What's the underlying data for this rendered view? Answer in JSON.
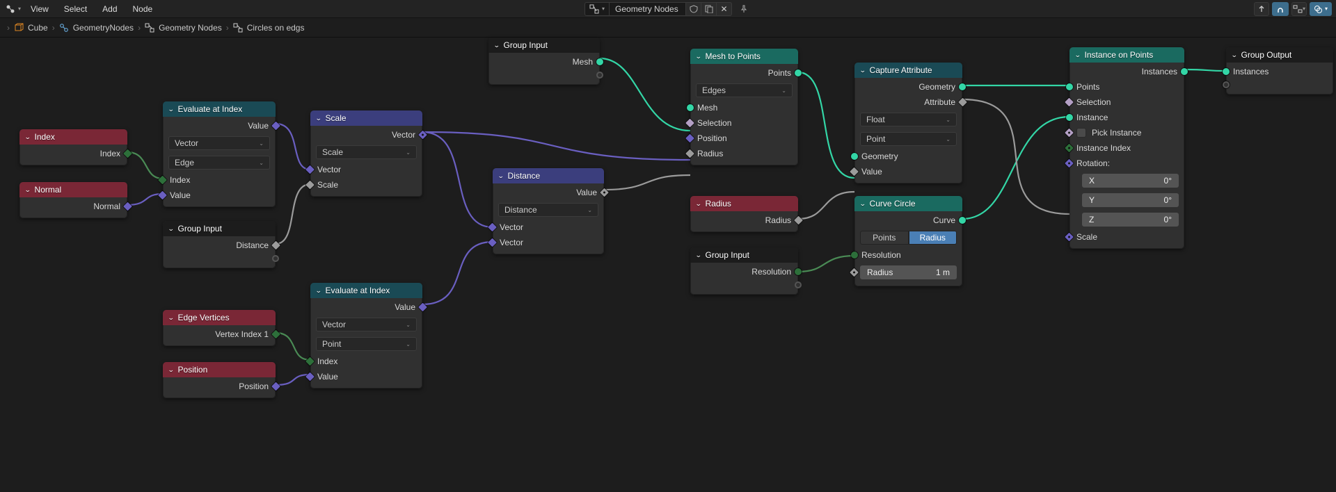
{
  "topbar": {
    "menu": [
      "View",
      "Select",
      "Add",
      "Node"
    ],
    "tree_type": "Geometry Nodes",
    "right_toggles": {}
  },
  "breadcrumb": {
    "items": [
      "Cube",
      "GeometryNodes",
      "Geometry Nodes",
      "Circles on edgs"
    ]
  },
  "nodes": {
    "group_input_top": {
      "title": "Group Input",
      "outs": {
        "mesh": "Mesh"
      }
    },
    "index": {
      "title": "Index",
      "outs": {
        "index": "Index"
      }
    },
    "normal": {
      "title": "Normal",
      "outs": {
        "normal": "Normal"
      }
    },
    "eval1": {
      "title": "Evaluate at Index",
      "outs": {
        "value": "Value"
      },
      "sel1": "Vector",
      "sel2": "Edge",
      "ins": {
        "index": "Index",
        "value": "Value"
      }
    },
    "group_input_mid": {
      "title": "Group Input",
      "outs": {
        "distance": "Distance"
      }
    },
    "edge_vertices": {
      "title": "Edge Vertices",
      "outs": {
        "v1": "Vertex Index 1"
      }
    },
    "position": {
      "title": "Position",
      "outs": {
        "position": "Position"
      }
    },
    "eval2": {
      "title": "Evaluate at Index",
      "outs": {
        "value": "Value"
      },
      "sel1": "Vector",
      "sel2": "Point",
      "ins": {
        "index": "Index",
        "value": "Value"
      }
    },
    "scale": {
      "title": "Scale",
      "outs": {
        "vector": "Vector"
      },
      "sel1": "Scale",
      "ins": {
        "vector": "Vector",
        "scale": "Scale"
      }
    },
    "distance": {
      "title": "Distance",
      "outs": {
        "value": "Value"
      },
      "sel1": "Distance",
      "ins": {
        "v1": "Vector",
        "v2": "Vector"
      }
    },
    "mesh_to_points": {
      "title": "Mesh to Points",
      "outs": {
        "points": "Points"
      },
      "sel1": "Edges",
      "ins": {
        "mesh": "Mesh",
        "selection": "Selection",
        "position": "Position",
        "radius": "Radius"
      }
    },
    "radius": {
      "title": "Radius",
      "outs": {
        "radius": "Radius"
      }
    },
    "group_input_res": {
      "title": "Group Input",
      "outs": {
        "resolution": "Resolution"
      }
    },
    "capture": {
      "title": "Capture Attribute",
      "outs": {
        "geometry": "Geometry",
        "attribute": "Attribute"
      },
      "sel1": "Float",
      "sel2": "Point",
      "ins": {
        "geometry": "Geometry",
        "value": "Value"
      }
    },
    "curve_circle": {
      "title": "Curve Circle",
      "outs": {
        "curve": "Curve"
      },
      "opts": {
        "points": "Points",
        "radius": "Radius"
      },
      "ins": {
        "resolution": "Resolution"
      },
      "radius_label": "Radius",
      "radius_val": "1 m"
    },
    "instance": {
      "title": "Instance on Points",
      "outs": {
        "instances": "Instances"
      },
      "ins": {
        "points": "Points",
        "selection": "Selection",
        "instance": "Instance",
        "pick": "Pick Instance",
        "index": "Instance Index",
        "rotation": "Rotation:",
        "scale": "Scale"
      },
      "rot": {
        "x_l": "X",
        "x_v": "0°",
        "y_l": "Y",
        "y_v": "0°",
        "z_l": "Z",
        "z_v": "0°"
      }
    },
    "group_output": {
      "title": "Group Output",
      "ins": {
        "instances": "Instances"
      }
    }
  }
}
